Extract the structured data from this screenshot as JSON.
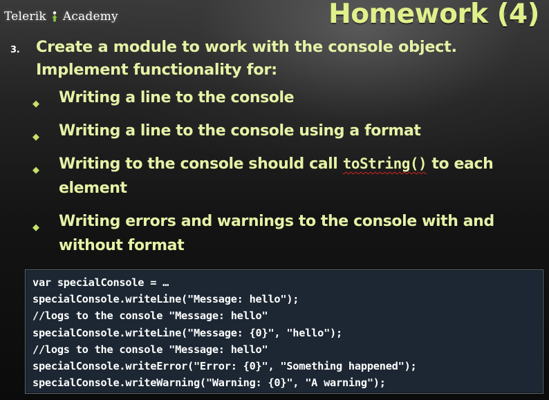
{
  "logo": {
    "text_before": "Telerik",
    "text_after": "Academy"
  },
  "title": "Homework (4)",
  "point": {
    "number": "3.",
    "text_line1": "Create a module to work with the console object.",
    "text_line2": "Implement functionality for:"
  },
  "sub_items": [
    {
      "text": "Writing a line to the console"
    },
    {
      "text": "Writing a line to the console using a format"
    },
    {
      "text_before": "Writing to the console should call ",
      "code": "toString()",
      "text_after": " to each element"
    },
    {
      "text": "Writing errors and warnings to the console with and without format"
    }
  ],
  "code_lines": [
    "var specialConsole = …",
    "specialConsole.writeLine(\"Message: hello\");",
    "//logs to the console \"Message: hello\"",
    "specialConsole.writeLine(\"Message: {0}\", \"hello\");",
    "//logs to the console \"Message: hello\"",
    "specialConsole.writeError(\"Error: {0}\", \"Something happened\");",
    "specialConsole.writeWarning(\"Warning: {0}\", \"A warning\");"
  ],
  "colors": {
    "title": "#e1f08a",
    "text": "#e6f2a6",
    "bullet": "#c7e06a",
    "code_bg": "#1c2733"
  }
}
